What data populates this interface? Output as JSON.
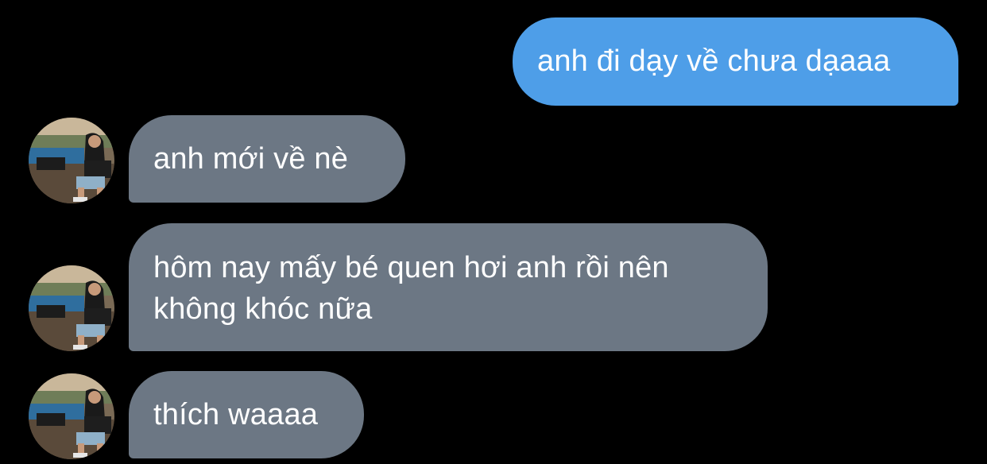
{
  "conversation": {
    "messages": [
      {
        "direction": "outgoing",
        "text": "anh đi dạy về chưa dạaaa"
      },
      {
        "direction": "incoming",
        "text": "anh mới về nè",
        "avatar": "contact-avatar"
      },
      {
        "direction": "incoming",
        "text": "hôm nay mấy bé quen hơi anh rồi nên không khóc nữa",
        "avatar": "contact-avatar"
      },
      {
        "direction": "incoming",
        "text": "thích waaaa",
        "avatar": "contact-avatar"
      }
    ]
  },
  "theme": {
    "background": "#000000",
    "outgoing_bubble": "#4e9ee8",
    "incoming_bubble": "#6c7784",
    "text": "#ffffff"
  }
}
